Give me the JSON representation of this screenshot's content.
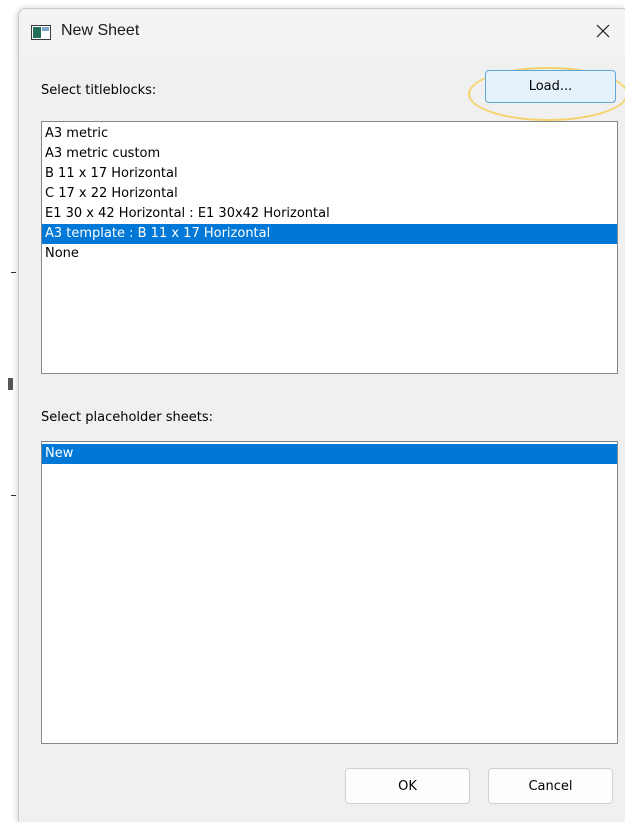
{
  "dialog": {
    "title": "New Sheet",
    "icon": "window-icon",
    "close_icon": "close-icon"
  },
  "titleblocks": {
    "label": "Select titleblocks:",
    "load_button": "Load...",
    "items": [
      "A3 metric",
      "A3 metric custom",
      "B 11 x 17 Horizontal",
      "C 17 x 22 Horizontal",
      "E1 30 x 42 Horizontal : E1 30x42 Horizontal",
      "A3 template : B 11 x 17 Horizontal",
      "None"
    ],
    "selected": "A3 template : B 11 x 17 Horizontal"
  },
  "placeholders": {
    "label": "Select placeholder sheets:",
    "items": [
      "New"
    ],
    "selected": "New"
  },
  "buttons": {
    "ok": "OK",
    "cancel": "Cancel"
  },
  "colors": {
    "selection": "#0078d7",
    "highlight": "#f5d36a"
  }
}
